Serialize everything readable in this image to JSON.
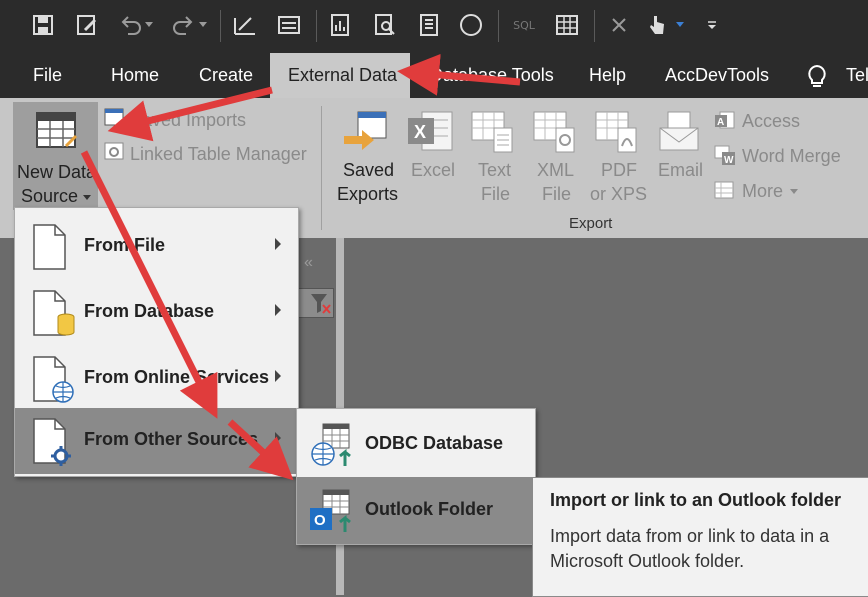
{
  "tabs": [
    {
      "label": "File"
    },
    {
      "label": "Home"
    },
    {
      "label": "Create"
    },
    {
      "label": "External Data"
    },
    {
      "label": "Database Tools"
    },
    {
      "label": "Help"
    },
    {
      "label": "AccDevTools"
    },
    {
      "label": "Tel"
    }
  ],
  "qat": {
    "sql_label": "SQL"
  },
  "ribbon": {
    "new_data_source_line1": "New Data",
    "new_data_source_line2": "Source",
    "saved_imports": "Saved Imports",
    "linked_table_manager": "Linked Table Manager",
    "saved_exports_line1": "Saved",
    "saved_exports_line2": "Exports",
    "excel": "Excel",
    "text_file_line1": "Text",
    "text_file_line2": "File",
    "xml_file_line1": "XML",
    "xml_file_line2": "File",
    "pdf_line1": "PDF",
    "pdf_line2": "or XPS",
    "email": "Email",
    "access": "Access",
    "word_merge": "Word Merge",
    "more": "More",
    "export_group": "Export"
  },
  "menu": {
    "items": [
      {
        "label": "From File"
      },
      {
        "label": "From Database"
      },
      {
        "label": "From Online Services"
      },
      {
        "label": "From Other Sources"
      }
    ]
  },
  "submenu": {
    "items": [
      {
        "label": "ODBC Database"
      },
      {
        "label": "Outlook Folder"
      }
    ]
  },
  "tooltip": {
    "title": "Import or link to an Outlook folder",
    "body": "Import data from or link to data in a Microsoft Outlook folder."
  },
  "colors": {
    "arrow": "#e03c3c",
    "ribbon": "#c6c6c6",
    "titlebar": "#2b2b2b"
  }
}
